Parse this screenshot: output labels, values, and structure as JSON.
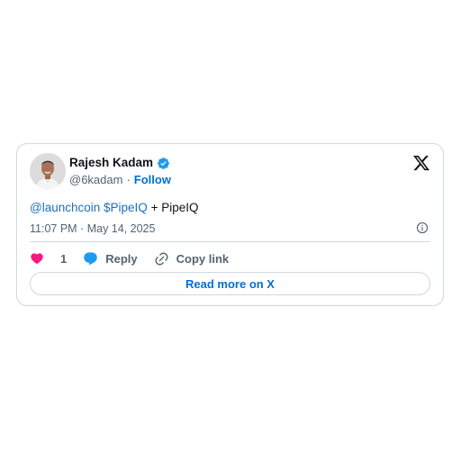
{
  "author": {
    "display_name": "Rajesh Kadam",
    "handle": "@6kadam",
    "separator": "·",
    "follow_label": "Follow",
    "verified": true
  },
  "tweet": {
    "mention": "@launchcoin",
    "cashtag": "$PipeIQ",
    "rest": "+ PipeIQ",
    "time": "11:07 PM",
    "meta_separator": "·",
    "date": "May 14, 2025"
  },
  "actions": {
    "like_count": "1",
    "reply_label": "Reply",
    "copy_link_label": "Copy link"
  },
  "read_more_label": "Read more on X",
  "colors": {
    "link": "#006fd6",
    "like": "#f91880",
    "reply": "#1d9bf0",
    "border": "#cfd9de",
    "muted": "#536471"
  },
  "icons": [
    "verified-badge-icon",
    "x-logo-icon",
    "info-icon",
    "heart-icon",
    "reply-bubble-icon",
    "link-icon"
  ]
}
